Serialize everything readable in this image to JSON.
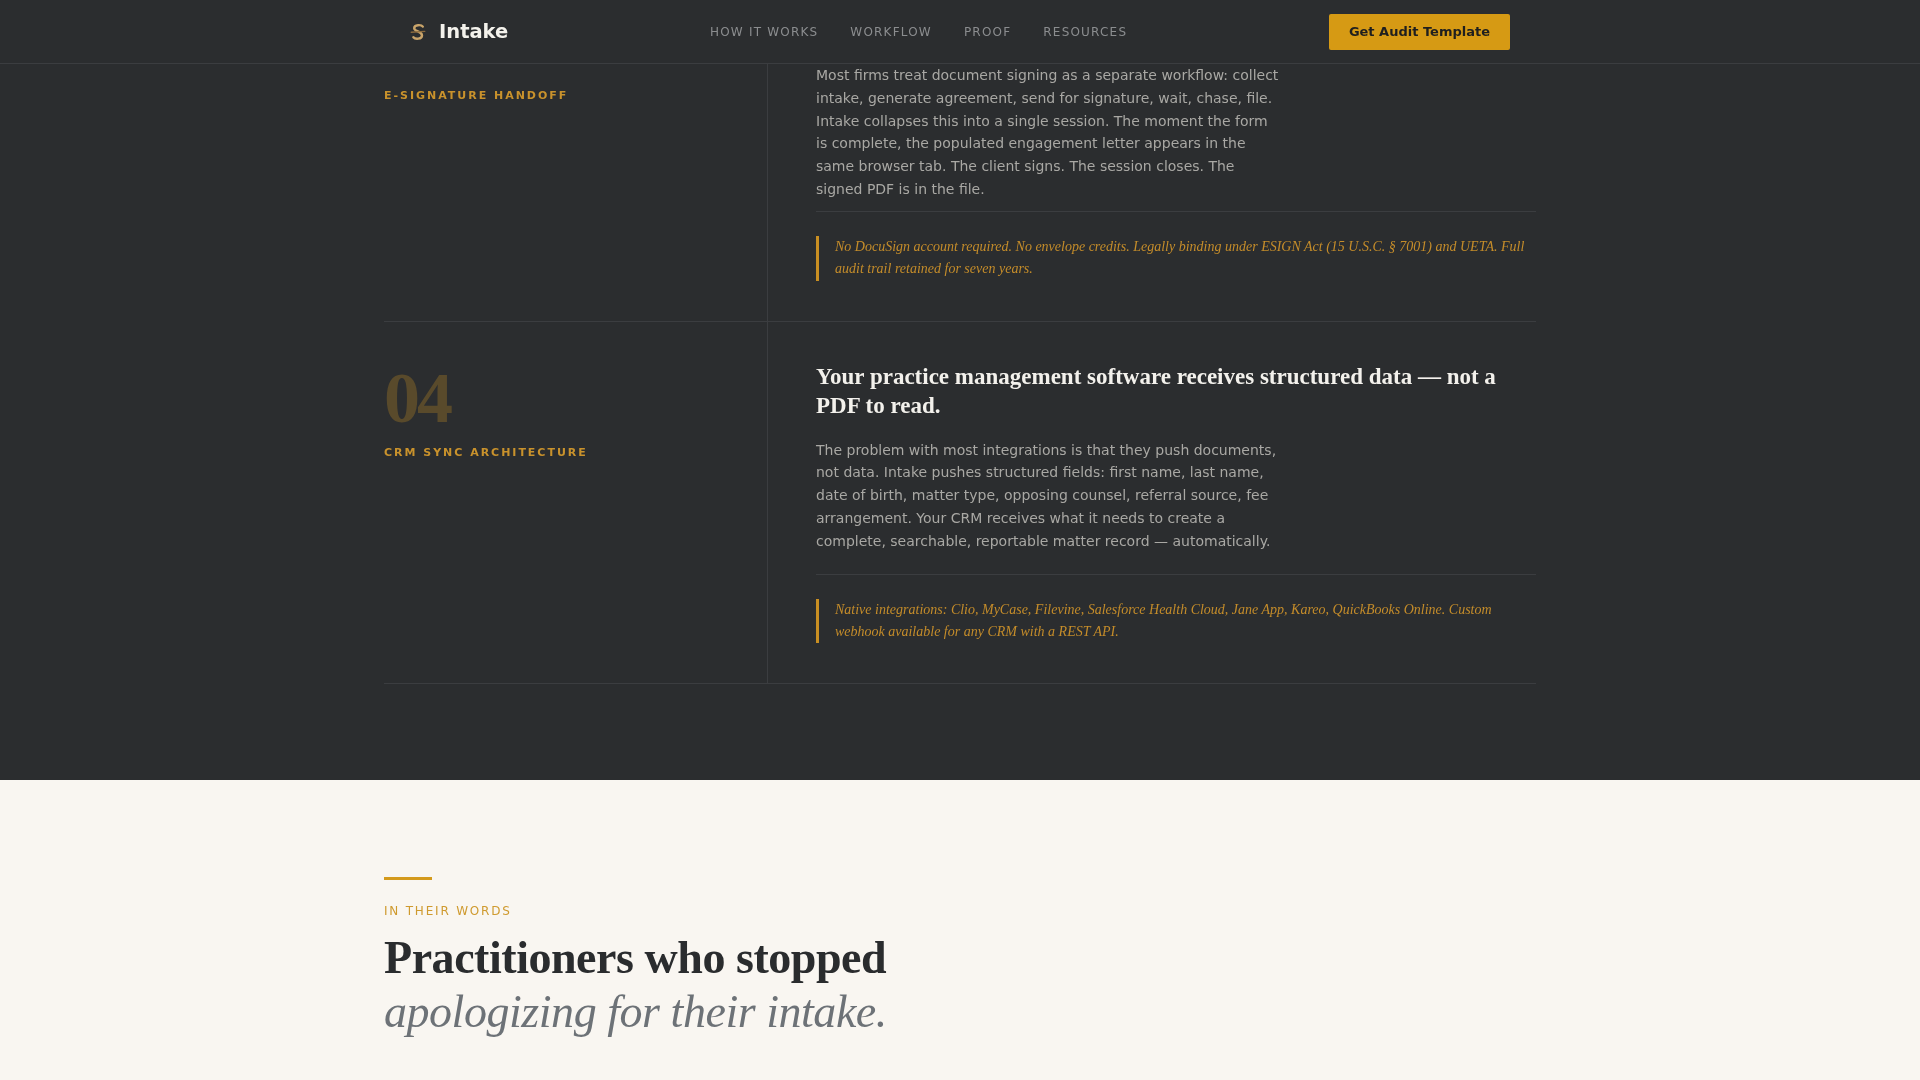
{
  "header": {
    "brand": "Intake",
    "nav": [
      "HOW IT WORKS",
      "WORKFLOW",
      "PROOF",
      "RESOURCES"
    ],
    "cta": "Get Audit Template"
  },
  "steps": [
    {
      "label": "E-SIGNATURE HANDOFF",
      "body": "Most firms treat document signing as a separate workflow: collect intake, generate agreement, send for signature, wait, chase, file. Intake collapses this into a single session. The moment the form is complete, the populated engagement letter appears in the same browser tab. The client signs. The session closes. The signed PDF is in the file.",
      "note": "No DocuSign account required. No envelope credits. Legally binding under ESIGN Act (15 U.S.C. § 7001) and UETA. Full audit trail retained for seven years."
    },
    {
      "number": "04",
      "label": "CRM SYNC ARCHITECTURE",
      "title": "Your practice management software receives structured data — not a PDF to read.",
      "body": "The problem with most integrations is that they push documents, not data. Intake pushes structured fields: first name, last name, date of birth, matter type, opposing counsel, referral source, fee arrangement. Your CRM receives what it needs to create a complete, searchable, reportable matter record — automatically.",
      "note": "Native integrations: Clio, MyCase, Filevine, Salesforce Health Cloud, Jane App, Kareo, QuickBooks Online. Custom webhook available for any CRM with a REST API."
    }
  ],
  "testimonials": {
    "eyebrow": "IN THEIR WORDS",
    "title": "Practitioners who stopped *apologizing for their intake.*"
  }
}
